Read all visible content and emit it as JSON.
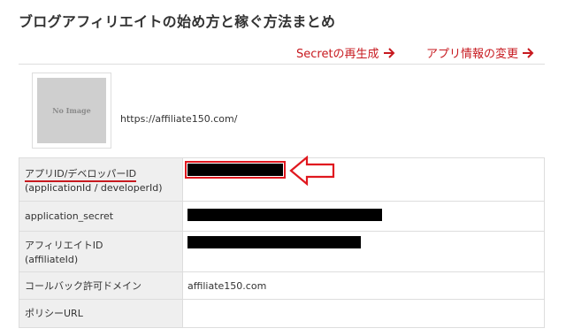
{
  "page": {
    "title": "ブログアフィリエイトの始め方と稼ぐ方法まとめ"
  },
  "actions": {
    "regenerate_secret": "Secretの再生成",
    "edit_app_info": "アプリ情報の変更",
    "arrow_glyph": "🡒"
  },
  "app": {
    "thumbnail_text": "No Image",
    "site_url": "https://affiliate150.com/"
  },
  "table": {
    "rows": [
      {
        "label": "アプリID/デベロッパーID",
        "sublabel": "(applicationId / developerId)",
        "value": ""
      },
      {
        "label": "application_secret",
        "sublabel": "",
        "value": ""
      },
      {
        "label": "アフィリエイトID",
        "sublabel": "(affiliateId)",
        "value": ""
      },
      {
        "label": "コールバック許可ドメイン",
        "sublabel": "",
        "value": "affiliate150.com"
      },
      {
        "label": "ポリシーURL",
        "sublabel": "",
        "value": ""
      }
    ]
  },
  "colors": {
    "accent": "#c7191f",
    "redact": "#000000",
    "label_bg": "#efefef",
    "border": "#dddddd"
  },
  "icons": {
    "action_arrow": "arrow-right-icon",
    "callout": "left-arrow-callout-icon"
  }
}
